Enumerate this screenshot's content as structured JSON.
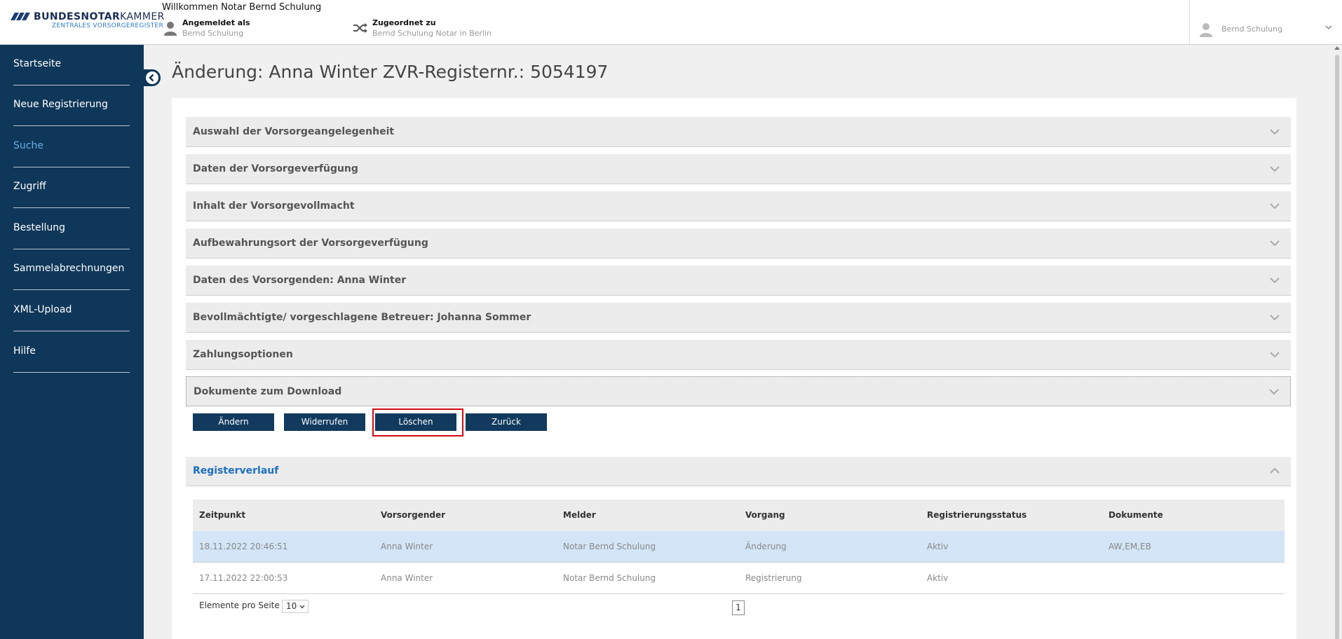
{
  "header": {
    "logo_brand_bold": "BUNDESNOTAR",
    "logo_brand_rest": "KAMMER",
    "logo_sub": "ZENTRALES VORSORGEREGISTER",
    "welcome": "Willkommen Notar Bernd Schulung",
    "login_title": "Angemeldet als",
    "login_value": "Bernd Schulung",
    "assign_title": "Zugeordnet zu",
    "assign_value": "Bernd Schulung Notar in Berlin",
    "user_name": "Bernd Schulung"
  },
  "sidebar": {
    "items": [
      {
        "label": "Startseite",
        "active": false
      },
      {
        "label": "Neue Registrierung",
        "active": false
      },
      {
        "label": "Suche",
        "active": true
      },
      {
        "label": "Zugriff",
        "active": false
      },
      {
        "label": "Bestellung",
        "active": false
      },
      {
        "label": "Sammelabrechnungen",
        "active": false
      },
      {
        "label": "XML-Upload",
        "active": false
      },
      {
        "label": "Hilfe",
        "active": false
      }
    ]
  },
  "main": {
    "title": "Änderung: Anna Winter ZVR-Registernr.: 5054197",
    "sections": [
      "Auswahl der Vorsorgeangelegenheit",
      "Daten der Vorsorgeverfügung",
      "Inhalt der Vorsorgevollmacht",
      "Aufbewahrungsort der Vorsorgeverfügung",
      "Daten des Vorsorgenden: Anna Winter",
      "Bevollmächtigte/ vorgeschlagene Betreuer: Johanna Sommer",
      "Zahlungsoptionen",
      "Dokumente zum Download"
    ],
    "buttons": {
      "edit": "Ändern",
      "revoke": "Widerrufen",
      "delete": "Löschen",
      "back": "Zurück"
    },
    "history": {
      "title": "Registerverlauf",
      "columns": [
        "Zeitpunkt",
        "Vorsorgender",
        "Melder",
        "Vorgang",
        "Registrierungsstatus",
        "Dokumente"
      ],
      "rows": [
        [
          "18.11.2022 20:46:51",
          "Anna Winter",
          "Notar Bernd Schulung",
          "Änderung",
          "Aktiv",
          "AW,EM,EB"
        ],
        [
          "17.11.2022 22:00:53",
          "Anna Winter",
          "Notar Bernd Schulung",
          "Registrierung",
          "Aktiv",
          ""
        ]
      ],
      "per_page_label": "Elemente pro Seite",
      "per_page_value": "10",
      "current_page": "1"
    }
  },
  "colors": {
    "sidebar_bg": "#0f3759",
    "sidebar_active": "#6aaee6",
    "button_bg": "#113a5e",
    "focus_outline": "#d20a11",
    "history_title": "#1c6ec0",
    "selected_row": "#d3e5f6"
  },
  "icons": {
    "user": "person-icon",
    "assign": "shuffle-icon",
    "chevron": "chevron-down-icon",
    "collapse": "chevron-left-circle-icon"
  }
}
